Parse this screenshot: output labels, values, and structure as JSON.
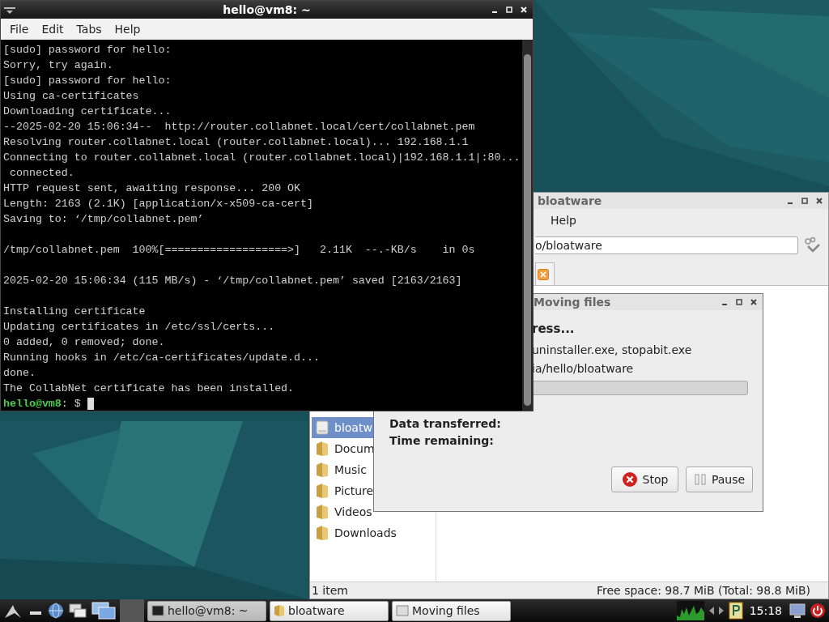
{
  "terminal": {
    "title": "hello@vm8: ~",
    "menu": [
      "File",
      "Edit",
      "Tabs",
      "Help"
    ],
    "lines": [
      {
        "kind": "text",
        "text": "[sudo] password for hello:"
      },
      {
        "kind": "text",
        "text": "Sorry, try again."
      },
      {
        "kind": "text",
        "text": "[sudo] password for hello:"
      },
      {
        "kind": "text",
        "text": "Using ca-certificates"
      },
      {
        "kind": "text",
        "text": "Downloading certificate..."
      },
      {
        "kind": "text",
        "text": "--2025-02-20 15:06:34--  http://router.collabnet.local/cert/collabnet.pem"
      },
      {
        "kind": "text",
        "text": "Resolving router.collabnet.local (router.collabnet.local)... 192.168.1.1"
      },
      {
        "kind": "text",
        "text": "Connecting to router.collabnet.local (router.collabnet.local)|192.168.1.1|:80..."
      },
      {
        "kind": "text",
        "text": " connected."
      },
      {
        "kind": "text",
        "text": "HTTP request sent, awaiting response... 200 OK"
      },
      {
        "kind": "text",
        "text": "Length: 2163 (2.1K) [application/x-x509-ca-cert]"
      },
      {
        "kind": "text",
        "text": "Saving to: ‘/tmp/collabnet.pem’"
      },
      {
        "kind": "blank"
      },
      {
        "kind": "text",
        "text": "/tmp/collabnet.pem  100%[===================>]   2.11K  --.-KB/s    in 0s"
      },
      {
        "kind": "blank"
      },
      {
        "kind": "text",
        "text": "2025-02-20 15:06:34 (115 MB/s) - ‘/tmp/collabnet.pem’ saved [2163/2163]"
      },
      {
        "kind": "blank"
      },
      {
        "kind": "text",
        "text": "Installing certificate"
      },
      {
        "kind": "text",
        "text": "Updating certificates in /etc/ssl/certs..."
      },
      {
        "kind": "text",
        "text": "0 added, 0 removed; done."
      },
      {
        "kind": "text",
        "text": "Running hooks in /etc/ca-certificates/update.d..."
      },
      {
        "kind": "text",
        "text": "done."
      },
      {
        "kind": "text",
        "text": "The CollabNet certificate has been installed."
      }
    ],
    "prompt": {
      "user": "hello@vm8",
      "rest": ": $"
    }
  },
  "file_manager": {
    "title": "bloatware",
    "menu": [
      "Help"
    ],
    "path": "o/bloatware",
    "sidebar": [
      {
        "label": "bloatw",
        "selected": true,
        "kind": "drive"
      },
      {
        "label": "Docum",
        "selected": false,
        "kind": "folder"
      },
      {
        "label": "Music",
        "selected": false,
        "kind": "folder"
      },
      {
        "label": "Picture",
        "selected": false,
        "kind": "folder"
      },
      {
        "label": "Videos",
        "selected": false,
        "kind": "folder"
      },
      {
        "label": "Downloads",
        "selected": false,
        "kind": "folder"
      }
    ],
    "status_bar": {
      "count": "1 item",
      "free_space": "Free space: 98.7 MiB (Total: 98.8 MiB)"
    }
  },
  "dialog": {
    "title": "Moving files",
    "heading": "ress...",
    "files": "uninstaller.exe, stopabit.exe",
    "destination": "ia/hello/bloatware",
    "progress": {
      "level": 0
    },
    "data_transferred": "Data transferred:",
    "time_remaining": "Time remaining:",
    "buttons": [
      "Stop",
      "Pause"
    ]
  },
  "taskbar": {
    "windows": [
      {
        "label": "hello@vm8: ~",
        "selected": true,
        "kind": "terminal"
      },
      {
        "label": "bloatware",
        "selected": false,
        "kind": "folder"
      },
      {
        "label": "Moving files",
        "selected": false,
        "kind": "dialog"
      }
    ],
    "clock": "15:18"
  }
}
